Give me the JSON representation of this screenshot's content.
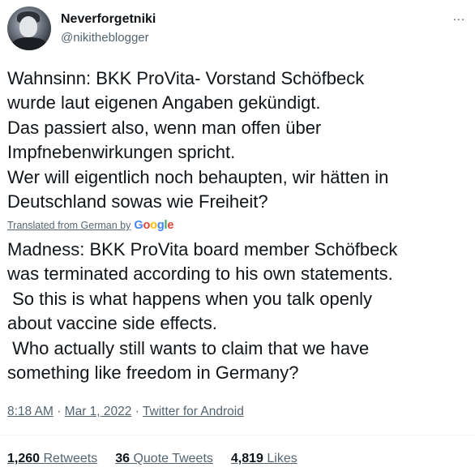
{
  "author": {
    "display_name": "Neverforgetniki",
    "handle": "@nikitheblogger",
    "avatar_icon": "user-avatar"
  },
  "more_icon": "…",
  "tweet": {
    "lines": [
      "Wahnsinn: BKK ProVita- Vorstand Schöfbeck",
      "wurde laut eigenen Angaben gekündigt.",
      "Das passiert also, wenn man offen über",
      "Impfnebenwirkungen spricht.",
      "Wer will eigentlich noch behaupten, wir hätten in",
      "Deutschland sowas wie Freiheit?"
    ]
  },
  "translation": {
    "label": "Translated from German by",
    "provider": "Google",
    "lines": [
      "Madness: BKK ProVita board member Schöfbeck",
      "was terminated according to his own statements.",
      " So this is what happens when you talk openly",
      "about vaccine side effects.",
      " Who actually still wants to claim that we have",
      "something like freedom in Germany?"
    ]
  },
  "meta": {
    "time": "8:18 AM",
    "separator": "·",
    "date": "Mar 1, 2022",
    "source": "Twitter for Android"
  },
  "stats": {
    "retweets_count": "1,260",
    "retweets_label": "Retweets",
    "quotes_count": "36",
    "quotes_label": "Quote Tweets",
    "likes_count": "4,819",
    "likes_label": "Likes"
  }
}
